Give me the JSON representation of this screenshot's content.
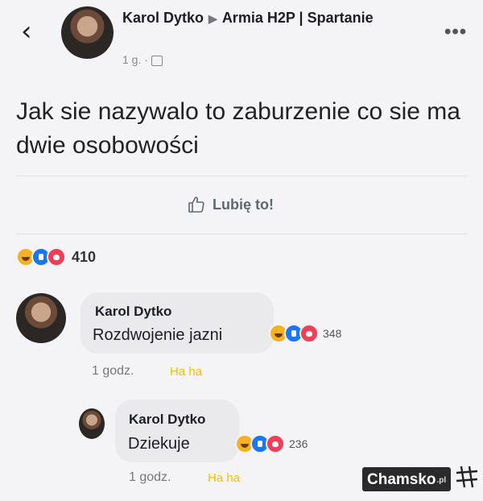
{
  "header": {
    "back_icon": "chevron-left-icon",
    "author": "Karol Dytko",
    "group": "Armia H2P | Spartanie",
    "time": "1 g. ·",
    "more_icon": "more-dots-icon"
  },
  "post": {
    "text": "Jak sie nazywalo to zaburzenie co sie ma dwie osobowości",
    "like_label": "Lubię to!",
    "reaction_count": "410"
  },
  "comments": [
    {
      "author": "Karol Dytko",
      "text": "Rozdwojenie jazni",
      "reaction_count": "348",
      "time": "1 godz.",
      "action": "Ha ha"
    },
    {
      "author": "Karol Dytko",
      "text": "Dziekuje",
      "reaction_count": "236",
      "time": "1 godz.",
      "action": "Ha ha"
    }
  ],
  "watermark": {
    "text": "Chamsko",
    "suffix": ".pl"
  },
  "colors": {
    "background": "#f4f4f6",
    "bubble": "#eaeaed",
    "haha_text": "#f2c200",
    "like_blue": "#1877f2",
    "love_red": "#f33e58",
    "haha_yellow": "#f7b125"
  }
}
